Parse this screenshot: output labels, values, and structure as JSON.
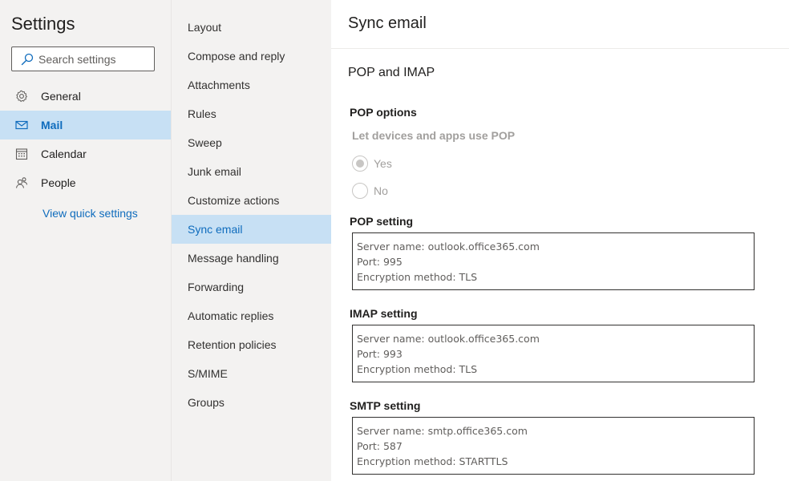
{
  "left": {
    "title": "Settings",
    "search_placeholder": "Search settings",
    "categories": [
      {
        "label": "General",
        "icon": "gear-icon"
      },
      {
        "label": "Mail",
        "icon": "mail-icon"
      },
      {
        "label": "Calendar",
        "icon": "calendar-icon"
      },
      {
        "label": "People",
        "icon": "people-icon"
      }
    ],
    "quick_settings": "View quick settings"
  },
  "mail_menu": {
    "items": [
      "Layout",
      "Compose and reply",
      "Attachments",
      "Rules",
      "Sweep",
      "Junk email",
      "Customize actions",
      "Sync email",
      "Message handling",
      "Forwarding",
      "Automatic replies",
      "Retention policies",
      "S/MIME",
      "Groups"
    ],
    "active": "Sync email"
  },
  "content": {
    "title": "Sync email",
    "section": "POP and IMAP",
    "pop_options": {
      "label": "POP options",
      "question": "Let devices and apps use POP",
      "yes": "Yes",
      "no": "No",
      "selected": "Yes"
    },
    "pop_setting": {
      "label": "POP setting",
      "server": "Server name: outlook.office365.com",
      "port": "Port: 995",
      "encryption": "Encryption method: TLS"
    },
    "imap_setting": {
      "label": "IMAP setting",
      "server": "Server name: outlook.office365.com",
      "port": "Port: 993",
      "encryption": "Encryption method: TLS"
    },
    "smtp_setting": {
      "label": "SMTP setting",
      "server": "Server name: smtp.office365.com",
      "port": "Port: 587",
      "encryption": "Encryption method: STARTTLS"
    }
  },
  "colors": {
    "accent": "#0f6cbd",
    "selected_bg": "#c7e0f4",
    "pane_bg": "#f3f2f1"
  }
}
